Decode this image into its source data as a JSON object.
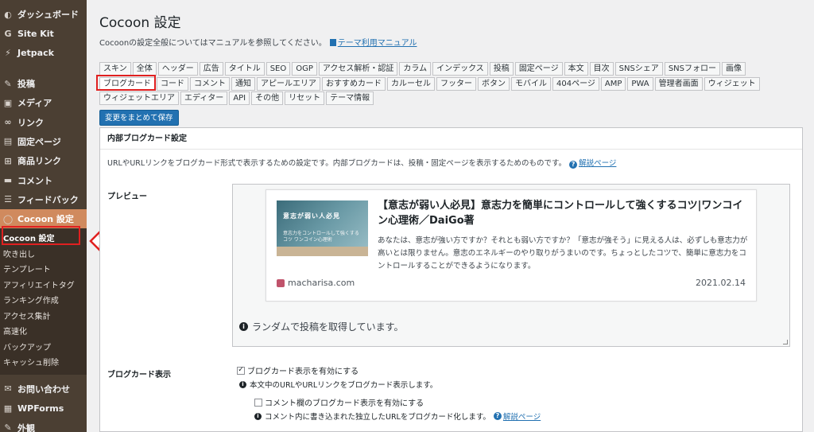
{
  "sidebar": {
    "items": [
      {
        "label": "ダッシュボード",
        "icon": "dashboard-icon",
        "glyph": "◐"
      },
      {
        "label": "Site Kit",
        "icon": "google-g-icon",
        "glyph": "G"
      },
      {
        "label": "Jetpack",
        "icon": "jetpack-icon",
        "glyph": "⚡"
      },
      {
        "label": "投稿",
        "icon": "pin-icon",
        "glyph": "✎"
      },
      {
        "label": "メディア",
        "icon": "media-icon",
        "glyph": "▣"
      },
      {
        "label": "リンク",
        "icon": "link-icon",
        "glyph": "∞"
      },
      {
        "label": "固定ページ",
        "icon": "pages-icon",
        "glyph": "▤"
      },
      {
        "label": "商品リンク",
        "icon": "cart-icon",
        "glyph": "⊞"
      },
      {
        "label": "コメント",
        "icon": "comment-icon",
        "glyph": "▬"
      },
      {
        "label": "フィードバック",
        "icon": "feedback-icon",
        "glyph": "☰"
      },
      {
        "label": "Cocoon 設定",
        "icon": "cocoon-icon",
        "glyph": "◯"
      }
    ],
    "submenu": [
      "Cocoon 設定",
      "吹き出し",
      "テンプレート",
      "アフィリエイトタグ",
      "ランキング作成",
      "アクセス集計",
      "高速化",
      "バックアップ",
      "キャッシュ削除"
    ],
    "bottom_items": [
      {
        "label": "お問い合わせ",
        "icon": "mail-icon",
        "glyph": "✉"
      },
      {
        "label": "WPForms",
        "icon": "wpforms-icon",
        "glyph": "▦"
      },
      {
        "label": "外観",
        "icon": "appearance-icon",
        "glyph": "✎"
      }
    ]
  },
  "header": {
    "title": "Cocoon 設定",
    "intro_text": "Cocoonの設定全般についてはマニュアルを参照してください。",
    "manual_link": "テーマ利用マニュアル"
  },
  "tabs": {
    "rows": [
      [
        "スキン",
        "全体",
        "ヘッダー",
        "広告",
        "タイトル",
        "SEO",
        "OGP",
        "アクセス解析・認証",
        "カラム",
        "インデックス",
        "投稿",
        "固定ページ",
        "本文",
        "目次",
        "SNSシェア",
        "SNSフォロー",
        "画像"
      ],
      [
        "ブログカード",
        "コード",
        "コメント",
        "通知",
        "アピールエリア",
        "おすすめカード",
        "カルーセル",
        "フッター",
        "ボタン",
        "モバイル",
        "404ページ",
        "AMP",
        "PWA",
        "管理者画面",
        "ウィジェット"
      ],
      [
        "ウィジェットエリア",
        "エディター",
        "API",
        "その他",
        "リセット",
        "テーマ情報"
      ]
    ],
    "active": "ブログカード"
  },
  "save_button": "変更をまとめて保存",
  "panel": {
    "heading": "内部ブログカード設定",
    "description": "URLやURLリンクをブログカード形式で表示するための設定です。内部ブログカードは、投稿・固定ページを表示するためのものです。",
    "help_link": "解説ページ",
    "preview_label": "プレビュー",
    "card": {
      "title": "【意志が弱い人必見】意志力を簡単にコントロールして強くするコツ|ワンコイン心理術／DaiGo著",
      "excerpt": "あなたは、意志が強い方ですか？それとも弱い方ですか？「意志が強そう」に見える人は、必ずしも意志力が高いとは限りません。意志のエネルギーのやり取りがうまいのです。ちょっとしたコツで、簡単に意志力をコントロールすることができるようになります。",
      "thumb_title": "意志が弱い人必見",
      "thumb_sub": "意志力をコントロールして強くするコツ ワンコイン心理術",
      "site": "macharisa.com",
      "date": "2021.02.14"
    },
    "random_note": "ランダムで投稿を取得しています。",
    "display_label": "ブログカード表示",
    "enable_option": "ブログカード表示を有効にする",
    "enable_note": "本文中のURLやURLリンクをブログカード表示します。",
    "comment_option": "コメント欄のブログカード表示を有効にする",
    "comment_note": "コメント内に書き込まれた独立したURLをブログカード化します。",
    "comment_help_link": "解説ページ"
  },
  "colors": {
    "sidebar_bg": "#4b3f33",
    "sidebar_active": "#d08a5e",
    "accent": "#2271b1",
    "highlight_red": "#e02020"
  }
}
